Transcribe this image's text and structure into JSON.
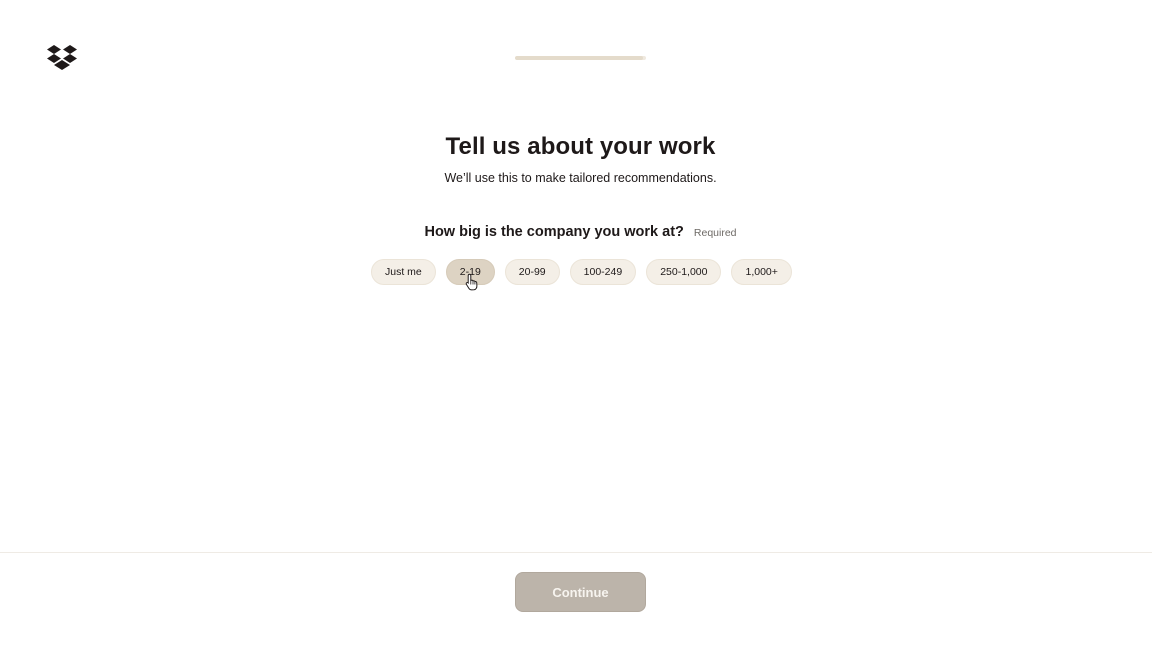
{
  "app": {
    "logo": "dropbox-logo-icon"
  },
  "progress": {
    "fraction": 0.98
  },
  "header": {
    "title": "Tell us about your work",
    "subtitle": "We’ll use this to make tailored recommendations."
  },
  "question": {
    "label": "How big is the company you work at?",
    "required_label": "Required",
    "options": [
      "Just me",
      "2-19",
      "20-99",
      "100-249",
      "250-1,000",
      "1,000+"
    ],
    "hovered_option": "2-19"
  },
  "footer": {
    "continue_label": "Continue"
  },
  "colors": {
    "text": "#1e1919",
    "chip_bg": "#f4efe7",
    "chip_hover_bg": "#ddd3c3",
    "button_disabled_bg": "#bcb4aa",
    "progress_track": "#efe9df"
  }
}
